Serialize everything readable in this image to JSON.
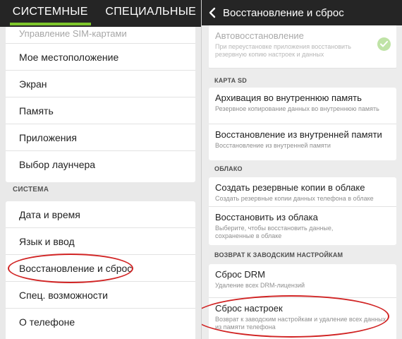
{
  "left": {
    "tabs": [
      {
        "label": "СИСТЕМНЫЕ",
        "active": true
      },
      {
        "label": "СПЕЦИАЛЬНЫЕ",
        "active": false
      }
    ],
    "top_items": [
      "Управление SIM-картами",
      "Мое местоположение",
      "Экран",
      "Память",
      "Приложения",
      "Выбор лаунчера"
    ],
    "system_header": "СИСТЕМА",
    "system_items": [
      "Дата и время",
      "Язык и ввод",
      "Восстановление и сброс",
      "Спец. возможности",
      "О телефоне"
    ]
  },
  "right": {
    "title": "Восстановление и сброс",
    "auto_restore": {
      "title": "Автовосстановление",
      "subtitle": "При переустановке приложения восстановить резервную копию настроек и данных",
      "checked": true
    },
    "sd_header": "КАРТА SD",
    "sd_items": [
      {
        "title": "Архивация во внутреннюю память",
        "subtitle": "Резервное копирование данных во внутреннюю память"
      },
      {
        "title": "Восстановление из внутренней памяти",
        "subtitle": "Восстановление из внутренней памяти"
      }
    ],
    "cloud_header": "ОБЛАКО",
    "cloud_items": [
      {
        "title": "Создать резервные копии в облаке",
        "subtitle": "Создать резервные копии данных телефона в облаке"
      },
      {
        "title": "Восстановить из облака",
        "subtitle": "Выберите, чтобы восстановить данные, сохраненные в облаке"
      }
    ],
    "factory_header": "ВОЗВРАТ К ЗАВОДСКИМ НАСТРОЙКАМ",
    "factory_items": [
      {
        "title": "Сброс DRM",
        "subtitle": "Удаление всех DRM-лицензий"
      },
      {
        "title": "Сброс настроек",
        "subtitle": "Возврат к заводским настройкам и удаление всех данных из памяти телефона"
      }
    ]
  },
  "colors": {
    "accent": "#7dc62b",
    "action_bar": "#252525",
    "highlight_oval": "#d12424",
    "check": "#bfe3a6"
  }
}
